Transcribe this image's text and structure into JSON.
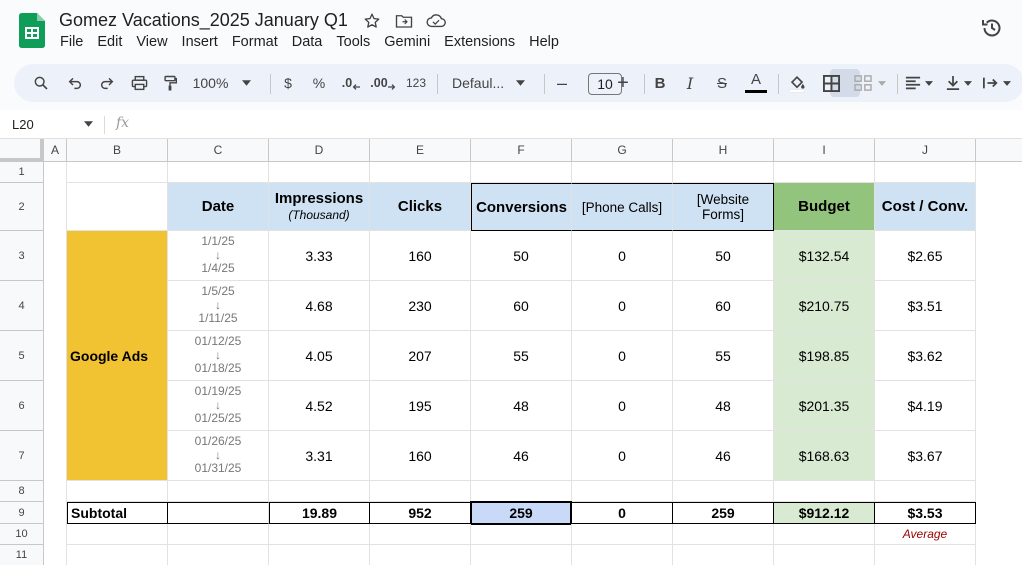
{
  "app": {
    "doc_title": "Gomez Vacations_2025 January Q1",
    "menu": [
      "File",
      "Edit",
      "View",
      "Insert",
      "Format",
      "Data",
      "Tools",
      "Gemini",
      "Extensions",
      "Help"
    ],
    "brand_color": "#0f9d58"
  },
  "toolbar": {
    "zoom": "100%",
    "currency": "$",
    "percent": "%",
    "dec_decrease": ".0",
    "dec_increase": ".00",
    "number_format": "123",
    "font_family": "Defaul...",
    "font_size": "10",
    "minus": "–",
    "plus": "+",
    "bold": "B",
    "italic": "I",
    "strike": "S",
    "text_color": "A"
  },
  "formula_bar": {
    "name_box": "L20",
    "fx_label": "fx"
  },
  "columns": [
    "A",
    "B",
    "C",
    "D",
    "E",
    "F",
    "G",
    "H",
    "I",
    "J"
  ],
  "rows": [
    "1",
    "2",
    "3",
    "4",
    "5",
    "6",
    "7",
    "8",
    "9",
    "10",
    "11"
  ],
  "table": {
    "headers": {
      "date": "Date",
      "impressions": "Impressions",
      "impressions_sub": "(Thousand)",
      "clicks": "Clicks",
      "conversions": "Conversions",
      "phone_calls": "[Phone Calls]",
      "website_forms_1": "[Website",
      "website_forms_2": "Forms]",
      "budget": "Budget",
      "cost_per_conv": "Cost / Conv."
    },
    "channel": "Google Ads",
    "rows": [
      {
        "date_start": "1/1/25",
        "date_end": "1/4/25",
        "impressions": "3.33",
        "clicks": "160",
        "conversions": "50",
        "phone_calls": "0",
        "website_forms": "50",
        "budget": "$132.54",
        "cost_per_conv": "$2.65"
      },
      {
        "date_start": "1/5/25",
        "date_end": "1/11/25",
        "impressions": "4.68",
        "clicks": "230",
        "conversions": "60",
        "phone_calls": "0",
        "website_forms": "60",
        "budget": "$210.75",
        "cost_per_conv": "$3.51"
      },
      {
        "date_start": "01/12/25",
        "date_end": "01/18/25",
        "impressions": "4.05",
        "clicks": "207",
        "conversions": "55",
        "phone_calls": "0",
        "website_forms": "55",
        "budget": "$198.85",
        "cost_per_conv": "$3.62"
      },
      {
        "date_start": "01/19/25",
        "date_end": "01/25/25",
        "impressions": "4.52",
        "clicks": "195",
        "conversions": "48",
        "phone_calls": "0",
        "website_forms": "48",
        "budget": "$201.35",
        "cost_per_conv": "$4.19"
      },
      {
        "date_start": "01/26/25",
        "date_end": "01/31/25",
        "impressions": "3.31",
        "clicks": "160",
        "conversions": "46",
        "phone_calls": "0",
        "website_forms": "46",
        "budget": "$168.63",
        "cost_per_conv": "$3.67"
      }
    ],
    "date_arrow": "↓",
    "subtotal": {
      "label": "Subtotal",
      "impressions": "19.89",
      "clicks": "952",
      "conversions": "259",
      "phone_calls": "0",
      "website_forms": "259",
      "budget": "$912.12",
      "cost_per_conv": "$3.53"
    },
    "average_note": "Average"
  },
  "colors": {
    "header_blue": "#cfe2f3",
    "budget_header_green": "#93c47d",
    "budget_green": "#d9ead3",
    "channel_yellow": "#f1c232",
    "selection_blue": "#c9daf8",
    "average_red": "#990000"
  }
}
